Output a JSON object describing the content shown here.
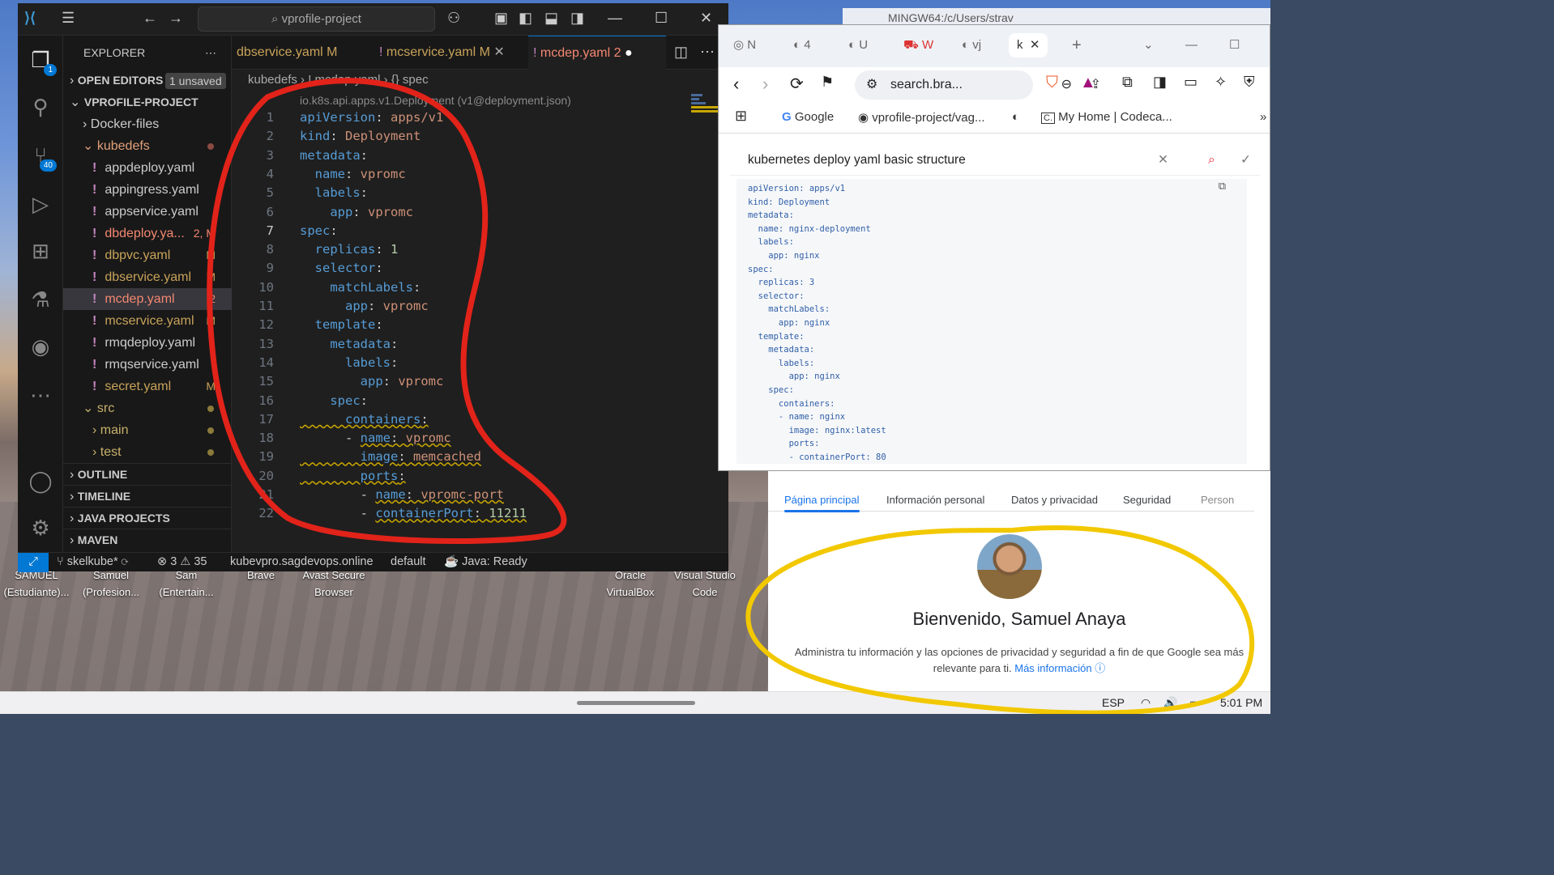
{
  "vscode": {
    "search_text": "vprofile-project",
    "explorer_title": "EXPLORER",
    "open_editors": "OPEN EDITORS",
    "unsaved_badge": "1 unsaved",
    "project": "VPROFILE-PROJECT",
    "tree": {
      "docker": "Docker-files",
      "kubedefs": "kubedefs",
      "files": [
        {
          "name": "appdeploy.yaml",
          "mark": ""
        },
        {
          "name": "appingress.yaml",
          "mark": ""
        },
        {
          "name": "appservice.yaml",
          "mark": ""
        },
        {
          "name": "dbdeploy.ya...",
          "mark": "2, M"
        },
        {
          "name": "dbpvc.yaml",
          "mark": "M"
        },
        {
          "name": "dbservice.yaml",
          "mark": "M"
        },
        {
          "name": "mcdep.yaml",
          "mark": "2"
        },
        {
          "name": "mcservice.yaml",
          "mark": "M"
        },
        {
          "name": "rmqdeploy.yaml",
          "mark": ""
        },
        {
          "name": "rmqservice.yaml",
          "mark": ""
        },
        {
          "name": "secret.yaml",
          "mark": "M"
        }
      ],
      "src": "src",
      "main": "main",
      "test": "test"
    },
    "sections": [
      "OUTLINE",
      "TIMELINE",
      "JAVA PROJECTS",
      "MAVEN"
    ],
    "activity_badges": {
      "explorer": "1",
      "scm": "40"
    },
    "tabs": [
      {
        "name": "dbservice.yaml",
        "mark": "M"
      },
      {
        "name": "mcservice.yaml",
        "mark": "M"
      },
      {
        "name": "mcdep.yaml",
        "mark": "2"
      }
    ],
    "breadcrumb": "kubedefs › ! mcdep.yaml › {} spec",
    "schema_hint": "io.k8s.api.apps.v1.Deployment (v1@deployment.json)",
    "code_lines": [
      [
        {
          "t": "apiVersion",
          "c": "k"
        },
        {
          "t": ": ",
          "c": "p"
        },
        {
          "t": "apps/v1",
          "c": "v"
        }
      ],
      [
        {
          "t": "kind",
          "c": "k"
        },
        {
          "t": ": ",
          "c": "p"
        },
        {
          "t": "Deployment",
          "c": "v"
        }
      ],
      [
        {
          "t": "metadata",
          "c": "k"
        },
        {
          "t": ":",
          "c": "p"
        }
      ],
      [
        {
          "t": "  name",
          "c": "k"
        },
        {
          "t": ": ",
          "c": "p"
        },
        {
          "t": "vpromc",
          "c": "v"
        }
      ],
      [
        {
          "t": "  labels",
          "c": "k"
        },
        {
          "t": ":",
          "c": "p"
        }
      ],
      [
        {
          "t": "    app",
          "c": "k"
        },
        {
          "t": ": ",
          "c": "p"
        },
        {
          "t": "vpromc",
          "c": "v"
        }
      ],
      [
        {
          "t": "spec",
          "c": "k"
        },
        {
          "t": ":",
          "c": "p"
        }
      ],
      [
        {
          "t": "  replicas",
          "c": "k"
        },
        {
          "t": ": ",
          "c": "p"
        },
        {
          "t": "1",
          "c": "n"
        }
      ],
      [
        {
          "t": "  selector",
          "c": "k"
        },
        {
          "t": ":",
          "c": "p"
        }
      ],
      [
        {
          "t": "    matchLabels",
          "c": "k"
        },
        {
          "t": ":",
          "c": "p"
        }
      ],
      [
        {
          "t": "      app",
          "c": "k"
        },
        {
          "t": ": ",
          "c": "p"
        },
        {
          "t": "vpromc",
          "c": "v"
        }
      ],
      [
        {
          "t": "  template",
          "c": "k"
        },
        {
          "t": ":",
          "c": "p"
        }
      ],
      [
        {
          "t": "    metadata",
          "c": "k"
        },
        {
          "t": ":",
          "c": "p"
        }
      ],
      [
        {
          "t": "      labels",
          "c": "k"
        },
        {
          "t": ":",
          "c": "p"
        }
      ],
      [
        {
          "t": "        app",
          "c": "k"
        },
        {
          "t": ": ",
          "c": "p"
        },
        {
          "t": "vpromc",
          "c": "v"
        }
      ],
      [
        {
          "t": "    spec",
          "c": "k"
        },
        {
          "t": ":",
          "c": "p"
        }
      ],
      [
        {
          "t": "      containers",
          "c": "k",
          "sq": true
        },
        {
          "t": ":",
          "c": "p",
          "sq": true
        }
      ],
      [
        {
          "t": "      - ",
          "c": "p"
        },
        {
          "t": "name",
          "c": "k",
          "sq": true
        },
        {
          "t": ": ",
          "c": "p",
          "sq": true
        },
        {
          "t": "vpromc",
          "c": "v",
          "sq": true
        }
      ],
      [
        {
          "t": "        image",
          "c": "k",
          "sq": true
        },
        {
          "t": ": ",
          "c": "p",
          "sq": true
        },
        {
          "t": "memcached",
          "c": "v",
          "sq": true
        }
      ],
      [
        {
          "t": "        ports",
          "c": "k",
          "sq": true
        },
        {
          "t": ":",
          "c": "p",
          "sq": true
        }
      ],
      [
        {
          "t": "        - ",
          "c": "p"
        },
        {
          "t": "name",
          "c": "k",
          "sq": true
        },
        {
          "t": ": ",
          "c": "p",
          "sq": true
        },
        {
          "t": "vpromc-port",
          "c": "v",
          "sq": true
        }
      ],
      [
        {
          "t": "        - ",
          "c": "p"
        },
        {
          "t": "containerPort",
          "c": "k",
          "sq": true
        },
        {
          "t": ": ",
          "c": "p",
          "sq": true
        },
        {
          "t": "11211",
          "c": "n",
          "sq": true
        }
      ]
    ],
    "current_line": 7,
    "status": {
      "branch": "skelkube*",
      "errors": "3",
      "warnings": "35",
      "cluster": "kubevpro.sagdevops.online",
      "namespace": "default",
      "java": "Java: Ready"
    }
  },
  "browser": {
    "tabs": [
      "N",
      "4",
      "U",
      "W",
      "vj",
      "k"
    ],
    "url": "search.bra...",
    "bookmarks": [
      "Google",
      "vprofile-project/vag...",
      "My Home | Codeca..."
    ],
    "query": "kubernetes deploy yaml basic structure",
    "snippet": [
      "apiVersion: apps/v1",
      "kind: Deployment",
      "metadata:",
      "  name: nginx-deployment",
      "  labels:",
      "    app: nginx",
      "spec:",
      "  replicas: 3",
      "  selector:",
      "    matchLabels:",
      "      app: nginx",
      "  template:",
      "    metadata:",
      "      labels:",
      "        app: nginx",
      "    spec:",
      "      containers:",
      "      - name: nginx",
      "        image: nginx:latest",
      "        ports:",
      "        - containerPort: 80"
    ]
  },
  "google": {
    "tabs": [
      "Página principal",
      "Información personal",
      "Datos y privacidad",
      "Seguridad",
      "Person"
    ],
    "welcome": "Bienvenido, Samuel Anaya",
    "desc": "Administra tu información y las opciones de privacidad y seguridad a fin de que Google sea más relevante para ti.",
    "link": "Más información"
  },
  "desktop": {
    "icons": [
      "SAMUEL\n(Estudiante)...",
      "Samuel\n(Profesion...",
      "Sam\n(Entertain...",
      "Brave",
      "Avast Secure\nBrowser",
      "Oracle\nVirtualBox",
      "Visual Studio\nCode"
    ],
    "git_window": "MINGW64:/c/Users/strav"
  },
  "taskbar": {
    "lang": "ESP",
    "time": "5:01 PM"
  },
  "colors": {
    "annotation_red": "#e2231a",
    "annotation_yellow": "#f2c800",
    "vscode_accent": "#0078d4",
    "google_blue": "#1a73e8"
  }
}
